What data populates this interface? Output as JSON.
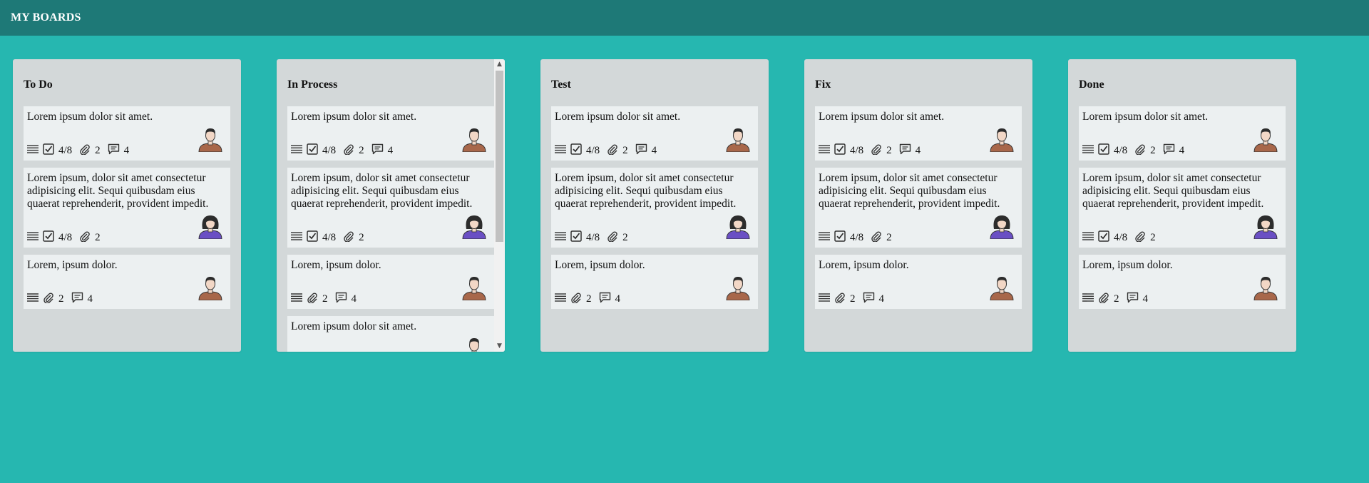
{
  "header": {
    "title": "MY BOARDS"
  },
  "colors": {
    "background": "#26b7b0",
    "header": "#1e7977",
    "column": "#d3d8d9",
    "card": "#ecf0f1"
  },
  "columns": [
    {
      "title": "To Do",
      "cards": [
        {
          "text": "Lorem ipsum dolor sit amet.",
          "checklist": "4/8",
          "attachments": "2",
          "comments": "4",
          "avatar": "male-avatar"
        },
        {
          "text": "Lorem ipsum, dolor sit amet consectetur adipisicing elit. Sequi quibusdam eius quaerat reprehenderit, provident impedit.",
          "checklist": "4/8",
          "attachments": "2",
          "avatar": "female-avatar"
        },
        {
          "text": "Lorem, ipsum dolor.",
          "attachments": "2",
          "comments": "4",
          "avatar": "male-avatar"
        }
      ]
    },
    {
      "title": "In Process",
      "cards": [
        {
          "text": "Lorem ipsum dolor sit amet.",
          "checklist": "4/8",
          "attachments": "2",
          "comments": "4",
          "avatar": "male-avatar"
        },
        {
          "text": "Lorem ipsum, dolor sit amet consectetur adipisicing elit. Sequi quibusdam eius quaerat reprehenderit, provident impedit.",
          "checklist": "4/8",
          "attachments": "2",
          "avatar": "female-avatar"
        },
        {
          "text": "Lorem, ipsum dolor.",
          "attachments": "2",
          "comments": "4",
          "avatar": "male-avatar"
        },
        {
          "text": "Lorem ipsum dolor sit amet.",
          "avatar": "male-avatar"
        }
      ]
    },
    {
      "title": "Test",
      "cards": [
        {
          "text": "Lorem ipsum dolor sit amet.",
          "checklist": "4/8",
          "attachments": "2",
          "comments": "4",
          "avatar": "male-avatar"
        },
        {
          "text": "Lorem ipsum, dolor sit amet consectetur adipisicing elit. Sequi quibusdam eius quaerat reprehenderit, provident impedit.",
          "checklist": "4/8",
          "attachments": "2",
          "avatar": "female-avatar"
        },
        {
          "text": "Lorem, ipsum dolor.",
          "attachments": "2",
          "comments": "4",
          "avatar": "male-avatar"
        }
      ]
    },
    {
      "title": "Fix",
      "cards": [
        {
          "text": "Lorem ipsum dolor sit amet.",
          "checklist": "4/8",
          "attachments": "2",
          "comments": "4",
          "avatar": "male-avatar"
        },
        {
          "text": "Lorem ipsum, dolor sit amet consectetur adipisicing elit. Sequi quibusdam eius quaerat reprehenderit, provident impedit.",
          "checklist": "4/8",
          "attachments": "2",
          "avatar": "female-avatar"
        },
        {
          "text": "Lorem, ipsum dolor.",
          "attachments": "2",
          "comments": "4",
          "avatar": "male-avatar"
        }
      ]
    },
    {
      "title": "Done",
      "cards": [
        {
          "text": "Lorem ipsum dolor sit amet.",
          "checklist": "4/8",
          "attachments": "2",
          "comments": "4",
          "avatar": "male-avatar"
        },
        {
          "text": "Lorem ipsum, dolor sit amet consectetur adipisicing elit. Sequi quibusdam eius quaerat reprehenderit, provident impedit.",
          "checklist": "4/8",
          "attachments": "2",
          "avatar": "female-avatar"
        },
        {
          "text": "Lorem, ipsum dolor.",
          "attachments": "2",
          "comments": "4",
          "avatar": "male-avatar"
        }
      ]
    }
  ]
}
